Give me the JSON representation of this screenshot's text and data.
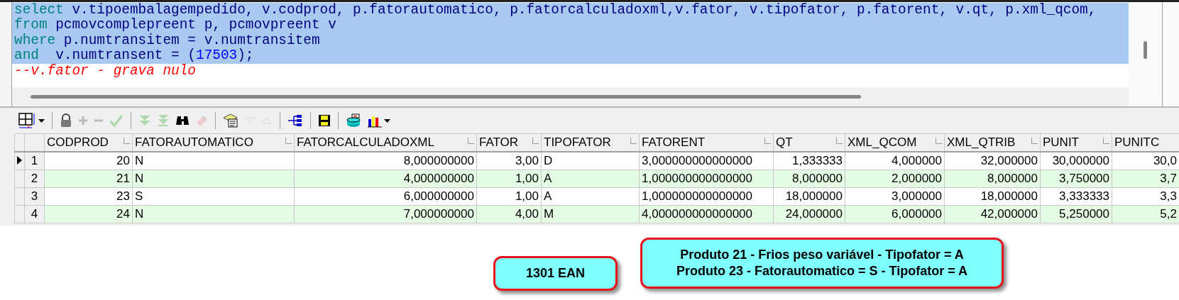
{
  "editor": {
    "lines": [
      {
        "selected": true,
        "tokens": [
          {
            "kind": "keyword",
            "text": "select"
          },
          {
            "kind": "ident",
            "text": " v.tipoembalagempedido, v.codprod, p.fatorautomatico, p.fatorcalculadoxml,v.fator, v.tipofator, p.fatorent, v.qt, p.xml_qcom,"
          }
        ]
      },
      {
        "selected": true,
        "tokens": [
          {
            "kind": "keyword",
            "text": "from"
          },
          {
            "kind": "ident",
            "text": " pcmovcomplepreent p, pcmovpreent v"
          }
        ]
      },
      {
        "selected": true,
        "tokens": [
          {
            "kind": "keyword",
            "text": "where"
          },
          {
            "kind": "ident",
            "text": " p.numtransitem = v.numtransitem"
          }
        ]
      },
      {
        "selected": true,
        "tokens": [
          {
            "kind": "keyword",
            "text": "and"
          },
          {
            "kind": "ident",
            "text": "  v.numtransent = ("
          },
          {
            "kind": "number",
            "text": "17503"
          },
          {
            "kind": "ident",
            "text": ");"
          }
        ]
      },
      {
        "selected": false,
        "tokens": [
          {
            "kind": "comment",
            "text": "--v.fator - grava nulo"
          }
        ]
      }
    ]
  },
  "toolbar": [
    {
      "kind": "grid",
      "disabled": false
    },
    {
      "kind": "sep"
    },
    {
      "kind": "lock",
      "disabled": false
    },
    {
      "kind": "plus",
      "disabled": true
    },
    {
      "kind": "minus",
      "disabled": true
    },
    {
      "kind": "check",
      "disabled": true
    },
    {
      "kind": "sep"
    },
    {
      "kind": "next",
      "disabled": true
    },
    {
      "kind": "last",
      "disabled": true
    },
    {
      "kind": "find",
      "disabled": false
    },
    {
      "kind": "eraser",
      "disabled": true
    },
    {
      "kind": "sep"
    },
    {
      "kind": "notes",
      "disabled": false
    },
    {
      "kind": "down",
      "disabled": true
    },
    {
      "kind": "up",
      "disabled": true
    },
    {
      "kind": "sep"
    },
    {
      "kind": "tree",
      "disabled": false
    },
    {
      "kind": "sep"
    },
    {
      "kind": "save",
      "disabled": false
    },
    {
      "kind": "sep"
    },
    {
      "kind": "db",
      "disabled": false
    },
    {
      "kind": "chart",
      "disabled": false
    }
  ],
  "table": {
    "columns": [
      "CODPROD",
      "FATORAUTOMATICO",
      "FATORCALCULADOXML",
      "FATOR",
      "TIPOFATOR",
      "FATORENT",
      "QT",
      "XML_QCOM",
      "XML_QTRIB",
      "PUNIT",
      "PUNITC"
    ],
    "rows": [
      {
        "number": "1",
        "selected": true,
        "cells": [
          "20",
          "N",
          "8,000000000",
          "3,00",
          "D",
          "3,000000000000000",
          "1,333333",
          "4,000000",
          "32,000000",
          "30,000000",
          "30,0"
        ]
      },
      {
        "number": "2",
        "selected": false,
        "cells": [
          "21",
          "N",
          "4,000000000",
          "1,00",
          "A",
          "1,000000000000000",
          "8,000000",
          "2,000000",
          "8,000000",
          "3,750000",
          "3,7"
        ]
      },
      {
        "number": "3",
        "selected": false,
        "cells": [
          "23",
          "S",
          "6,000000000",
          "1,00",
          "A",
          "1,000000000000000",
          "18,000000",
          "3,000000",
          "18,000000",
          "3,333333",
          "3,3"
        ]
      },
      {
        "number": "4",
        "selected": false,
        "cells": [
          "24",
          "N",
          "7,000000000",
          "4,00",
          "M",
          "4,000000000000000",
          "24,000000",
          "6,000000",
          "42,000000",
          "5,250000",
          "5,2"
        ]
      }
    ]
  },
  "callouts": [
    {
      "lines": [
        "1301 EAN"
      ]
    },
    {
      "lines": [
        "Produto 21 - Frios peso variável - Tipofator = A",
        "Produto 23 - Fatorautomatico = S - Tipofator = A"
      ]
    }
  ]
}
